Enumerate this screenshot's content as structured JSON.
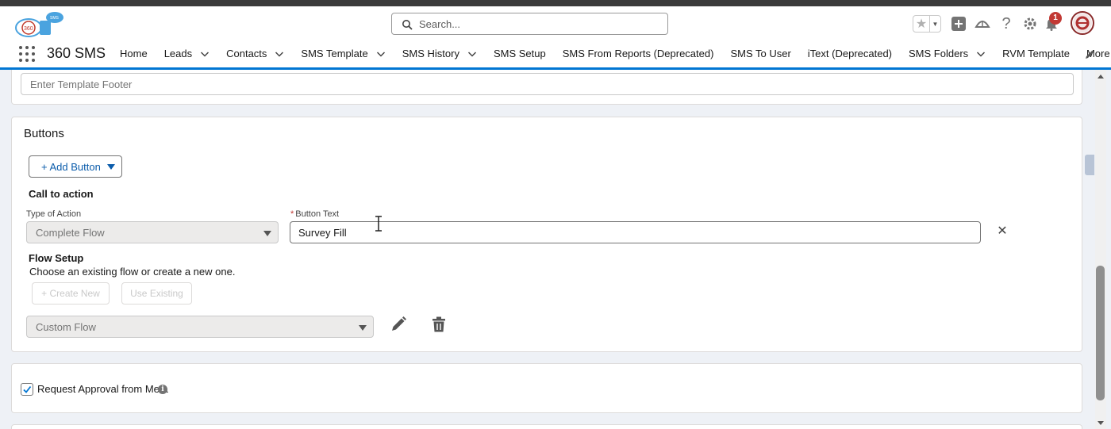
{
  "header": {
    "search_placeholder": "Search...",
    "notification_count": "1"
  },
  "nav": {
    "app_name": "360 SMS",
    "items": [
      {
        "label": "Home",
        "has_menu": false
      },
      {
        "label": "Leads",
        "has_menu": true
      },
      {
        "label": "Contacts",
        "has_menu": true
      },
      {
        "label": "SMS Template",
        "has_menu": true
      },
      {
        "label": "SMS History",
        "has_menu": true
      },
      {
        "label": "SMS Setup",
        "has_menu": false
      },
      {
        "label": "SMS From Reports (Deprecated)",
        "has_menu": false
      },
      {
        "label": "SMS To User",
        "has_menu": false
      },
      {
        "label": "iText (Deprecated)",
        "has_menu": false
      },
      {
        "label": "SMS Folders",
        "has_menu": true
      },
      {
        "label": "RVM Template",
        "has_menu": false
      }
    ],
    "more_label": "More"
  },
  "footer_section": {
    "footer_placeholder": "Enter Template Footer"
  },
  "buttons_section": {
    "title": "Buttons",
    "add_button_label": "+ Add Button",
    "call_to_action_title": "Call to action",
    "type_of_action_label": "Type of Action",
    "type_of_action_value": "Complete Flow",
    "button_text_required": "*",
    "button_text_label": "Button Text",
    "button_text_value": "Survey Fill",
    "flow_setup_title": "Flow Setup",
    "flow_setup_desc": "Choose an existing flow or create a new one.",
    "create_new_label": "+ Create New",
    "use_existing_label": "Use Existing",
    "flow_select_value": "Custom Flow"
  },
  "approval_section": {
    "checkbox_checked": true,
    "label": "Request Approval from Meta"
  },
  "colors": {
    "brand_blue": "#0176d3",
    "link_blue": "#0b5cab",
    "notification_red": "#c23934"
  }
}
